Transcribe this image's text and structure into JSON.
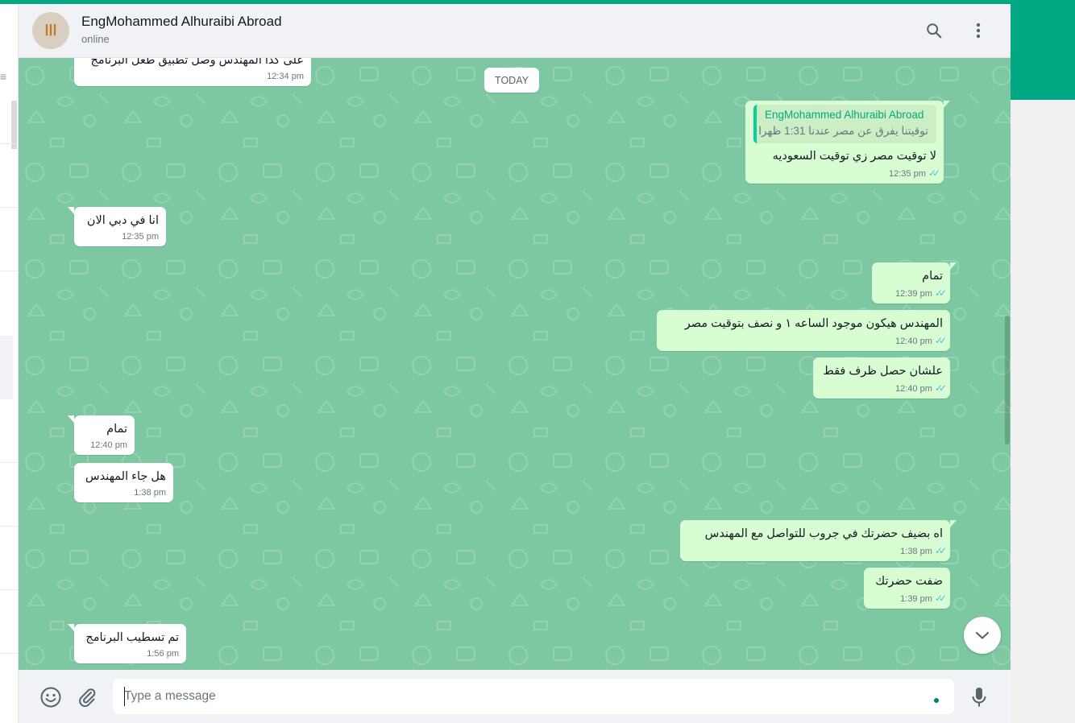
{
  "contact": {
    "name": "EngMohammed Alhuraibi Abroad",
    "status": "online",
    "avatar_text": "ااا"
  },
  "date_divider": "TODAY",
  "messages": {
    "m0": {
      "direction": "in",
      "text": "على كدا المهندس وصل تطبيق طعل البرنامج",
      "time": "12:34 pm"
    },
    "m1": {
      "direction": "out",
      "quote_author": "EngMohammed Alhuraibi Abroad",
      "quote_text": "توقيتنا يفرق عن مصر عندنا 1:31 ظهرا",
      "text": "لا توقيت مصر زي توقيت السعوديه",
      "time": "12:35 pm"
    },
    "m2": {
      "direction": "in",
      "text": "انا في دبي الان",
      "time": "12:35 pm"
    },
    "m3": {
      "direction": "out",
      "text": "تمام",
      "time": "12:39 pm"
    },
    "m4": {
      "direction": "out",
      "text": "المهندس هيكون موجود الساعه ١ و نصف بتوقيت مصر",
      "time": "12:40 pm"
    },
    "m5": {
      "direction": "out",
      "text": "علشان حصل ظرف فقط",
      "time": "12:40 pm"
    },
    "m6": {
      "direction": "in",
      "text": "تمام",
      "time": "12:40 pm"
    },
    "m7": {
      "direction": "in",
      "text": "هل جاء المهندس",
      "time": "1:38 pm"
    },
    "m8": {
      "direction": "out",
      "text": "اه بضيف حضرتك في جروب للتواصل مع المهندس",
      "time": "1:38 pm"
    },
    "m9": {
      "direction": "out",
      "text": "ضفت حضرتك",
      "time": "1:39 pm"
    },
    "m10": {
      "direction": "in",
      "text": "تم تسطيب البرنامج",
      "time": "1:56 pm"
    }
  },
  "composer": {
    "placeholder": "Type a message"
  },
  "icons": {
    "search": "search-icon",
    "menu": "kebab-menu-icon",
    "emoji": "emoji-icon",
    "attach": "paperclip-icon",
    "mic": "microphone-icon",
    "scroll_down": "chevron-down-icon",
    "read": "double-check-icon"
  },
  "colors": {
    "accent": "#00a884",
    "chat_background": "#7dc8a3",
    "outgoing_bubble": "#d9fdd3",
    "incoming_bubble": "#ffffff",
    "read_ticks": "#53bdeb",
    "quote_author": "#06a884"
  }
}
